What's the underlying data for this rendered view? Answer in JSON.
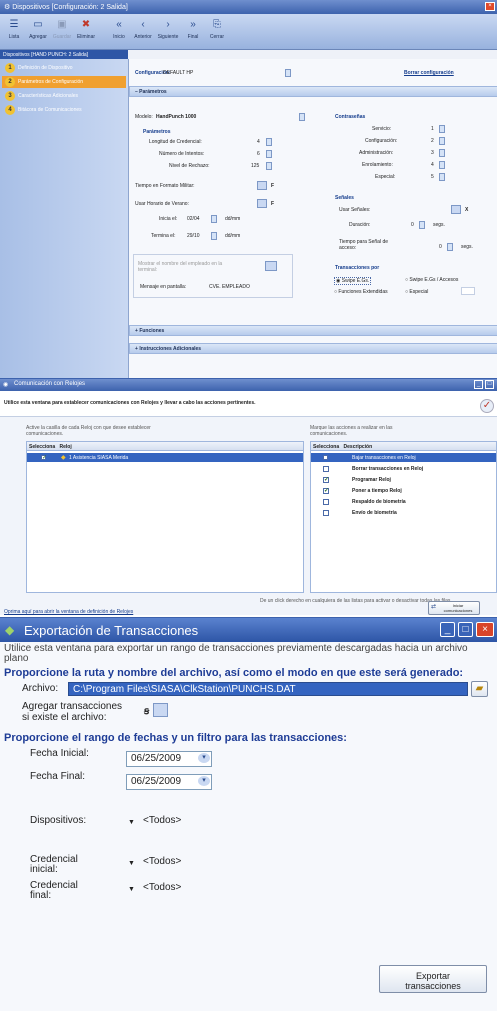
{
  "win1": {
    "title": "Dispositivos [Configuración: 2 Salida]",
    "toolbar": [
      {
        "label": "Lista",
        "icon": "list-icon"
      },
      {
        "label": "Agregar",
        "icon": "add-icon"
      },
      {
        "label": "Guardar",
        "icon": "save-icon"
      },
      {
        "label": "Eliminar",
        "icon": "delete-icon"
      },
      {
        "label": "Inicio",
        "icon": "first-icon"
      },
      {
        "label": "Anterior",
        "icon": "previous-icon"
      },
      {
        "label": "Siguiente",
        "icon": "next-icon"
      },
      {
        "label": "Final",
        "icon": "last-icon"
      },
      {
        "label": "Cerrar",
        "icon": "close-icon"
      }
    ],
    "device_strip": "Dispositivos [HAND PUNCH: 2 Salida]",
    "steps": [
      {
        "num": "1",
        "label": "Definición de Dispositivo"
      },
      {
        "num": "2",
        "label": "Parámetros de Configuración"
      },
      {
        "num": "3",
        "label": "Características Adicionales"
      },
      {
        "num": "4",
        "label": "Bitácora de Comunicaciones"
      }
    ],
    "config_label": "Configuración:",
    "config_value": "DEFAULT HP",
    "delete_config": "Borrar configuración",
    "section_params": "Parámetros",
    "modelo_label": "Modelo:",
    "modelo_value": "HandPunch 1000",
    "params_title": "Parámetros",
    "longitud_label": "Longitud de Credencial:",
    "longitud_value": "4",
    "intentos_label": "Número de Intentos:",
    "intentos_value": "6",
    "nivel_label": "Nivel de Rechazo:",
    "nivel_value": "125",
    "militar_label": "Tiempo en Formato Militar:",
    "militar_flag": "F",
    "verano_label": "Usar Horario de Verano:",
    "verano_flag": "F",
    "inicio_label": "Inicia el:",
    "inicio_value": "02/04",
    "inicio_unit": "dd/mm",
    "termina_label": "Termina el:",
    "termina_value": "29/10",
    "termina_unit": "dd/mm",
    "mostrar_label": "Mostrar el nombre del empleado en la terminal:",
    "mensaje_label": "Mensaje en pantalla:",
    "mensaje_value": "CVE. EMPLEADO",
    "contrasenas_title": "Contraseñas",
    "servicio_label": "Servicio:",
    "servicio_value": "1",
    "configuracion_label": "Configuración:",
    "configuracion_value": "2",
    "administracion_label": "Administración:",
    "administracion_value": "3",
    "enrolamiento_label": "Enrolamiento:",
    "enrolamiento_value": "4",
    "especial_label": "Especial:",
    "especial_value": "5",
    "senales_title": "Señales",
    "usar_senales_label": "Usar Señales:",
    "usar_senales_flag": "X",
    "duracion_label": "Duración:",
    "duracion_value": "0",
    "duracion_unit": "segs.",
    "senal_acceso_label": "Tiempo para Señal de acceso:",
    "senal_acceso_value": "0",
    "senal_acceso_unit": "segs.",
    "transacciones_title": "Transacciones por",
    "radio_options": [
      "Swipe E.Gs.",
      "Swipe E.Gs / Accesos",
      "Funciones Extendidas",
      "Especial"
    ],
    "funciones": "Funciones",
    "instrucciones": "Instrucciones Adicionales"
  },
  "win2": {
    "title": "Comunicación con Relojes",
    "description": "Utilice esta ventana para establecer comunicaciones con Relojes y llevar a cabo las acciones pertinentes.",
    "left_hint": "Active la casilla de cada Reloj con que desee establecer comunicaciones.",
    "left_cols": [
      "Selecciona",
      "Reloj"
    ],
    "left_rows": [
      "1 Asistencia SIASA Merida"
    ],
    "right_hint": "Marque las acciones a realizar en las comunicaciones.",
    "right_cols": [
      "Selecciona",
      "Descripción"
    ],
    "right_rows": [
      {
        "label": "Bajar transacciones en Reloj",
        "checked": false
      },
      {
        "label": "Borrar transacciones en Reloj",
        "checked": false
      },
      {
        "label": "Programar Reloj",
        "checked": true
      },
      {
        "label": "Poner a tiempo Reloj",
        "checked": true
      },
      {
        "label": "Respaldo de biometría",
        "checked": false
      },
      {
        "label": "Envío de biometría",
        "checked": false
      }
    ],
    "footer_hint": "De un click derecho en cualquiera de las listas para activar o desactivar todas las filas",
    "link": "Oprima aquí para abrir la ventana de definición de Relojes",
    "start_button": "Iniciar comunicaciones"
  },
  "win3": {
    "title": "Exportación de Transacciones",
    "description": "Utilice esta ventana para exportar un rango de transacciones previamente descargadas hacia un archivo plano",
    "section1": "Proporcione la ruta y nombre del archivo, así como el modo en que este será generado:",
    "archivo_label": "Archivo:",
    "archivo_value": "C:\\Program Files\\SIASA\\ClkStation\\PUNCHS.DAT",
    "agregar_label": "Agregar transacciones si existe el archivo:",
    "section2": "Proporcione el rango de fechas y un filtro para las transacciones:",
    "fecha_inicial_label": "Fecha Inicial:",
    "fecha_inicial_value": "06/25/2009",
    "fecha_final_label": "Fecha Final:",
    "fecha_final_value": "06/25/2009",
    "dispositivos_label": "Dispositivos:",
    "dispositivos_value": "<Todos>",
    "cred_inicial_label": "Credencial inicial:",
    "cred_inicial_value": "<Todos>",
    "cred_final_label": "Credencial final:",
    "cred_final_value": "<Todos>",
    "export_button": "Exportar transacciones"
  }
}
